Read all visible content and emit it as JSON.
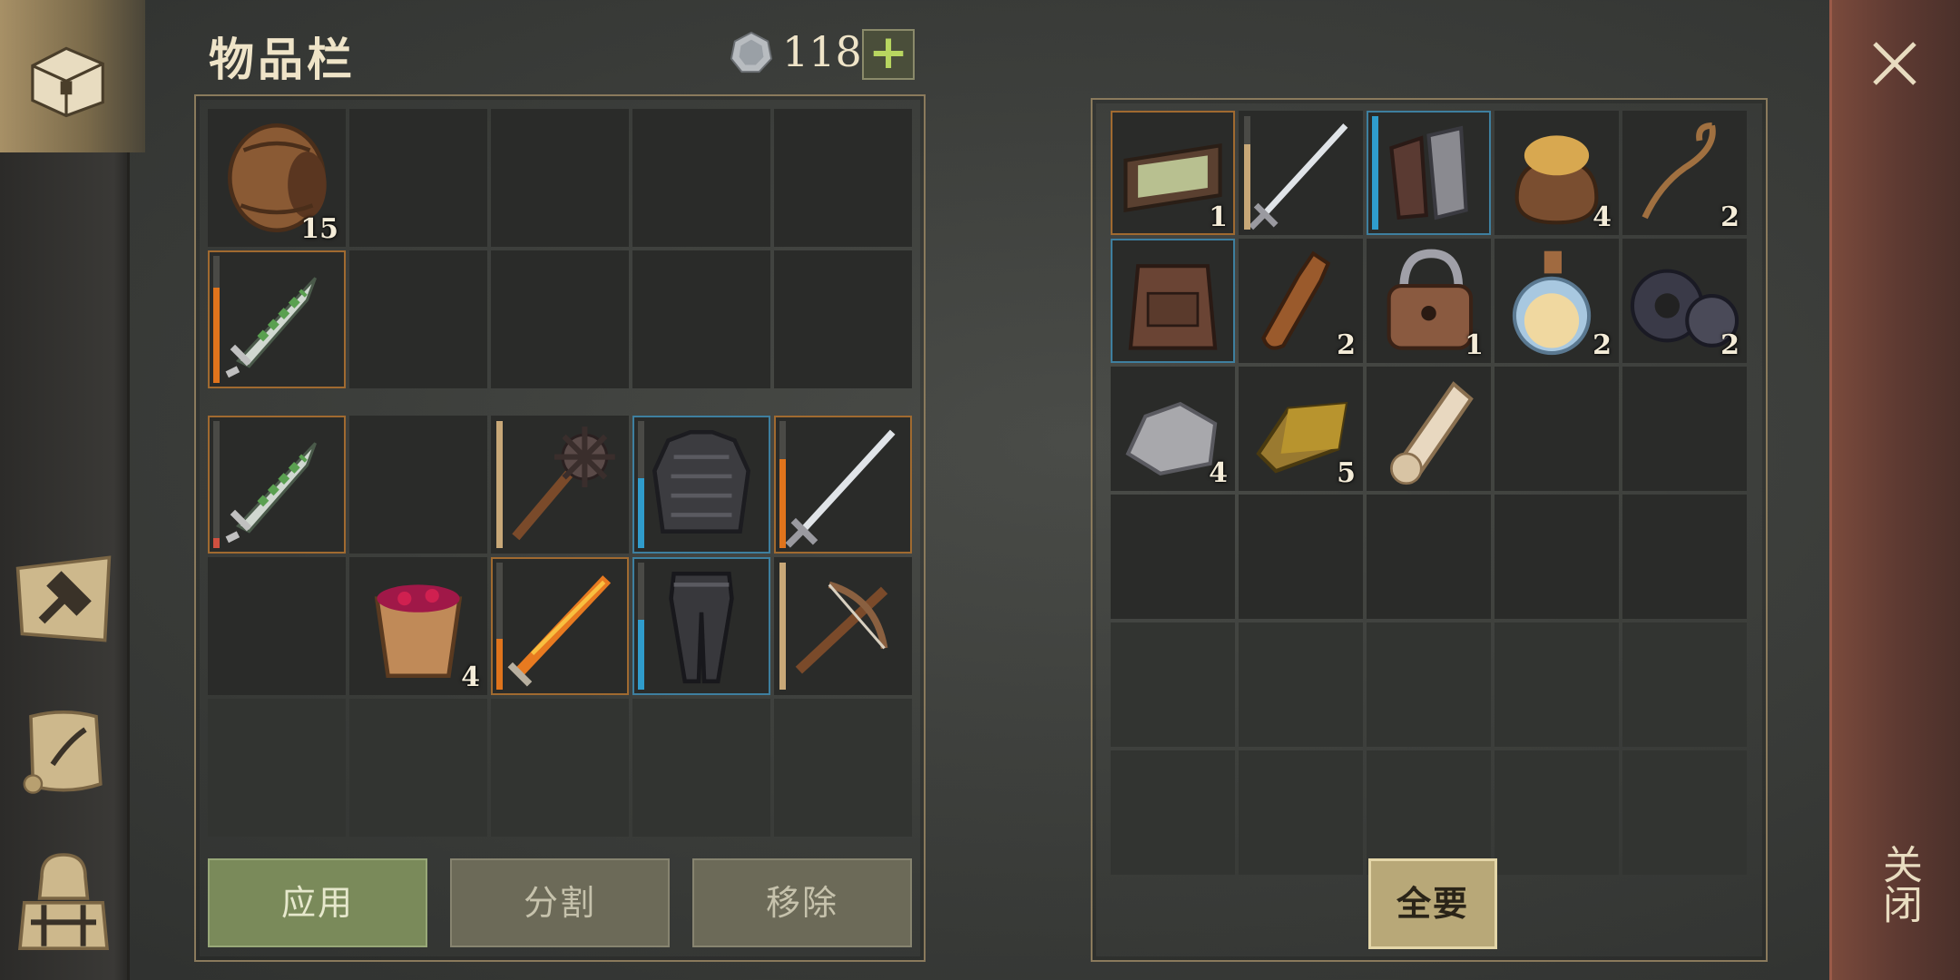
{
  "title": "物品栏",
  "currency": {
    "count": "118",
    "add_label": "+"
  },
  "buttons": {
    "apply": "应用",
    "split": "分割",
    "remove": "移除",
    "take_all": "全要"
  },
  "close": {
    "label": "关闭"
  },
  "nav": [
    "inventory-chest-icon",
    "crafting-hammer-icon",
    "journal-scroll-icon",
    "character-backpack-icon"
  ],
  "colors": {
    "rare_orange": "#e0741c",
    "rare_blue": "#2f9ccc",
    "tan": "#c8a878",
    "accent_green": "#b8d660"
  },
  "inventory_top": [
    {
      "icon": "barrel-icon",
      "qty": "15"
    },
    {},
    {},
    {},
    {},
    {
      "icon": "dagger-icon",
      "rarity": "orange",
      "durability": 0.75
    },
    {},
    {},
    {},
    {}
  ],
  "inventory_equip": [
    {
      "icon": "dagger-icon",
      "rarity": "orange",
      "durability": 0.08,
      "durColor": "#d05040"
    },
    {},
    {
      "icon": "mace-icon",
      "durability": 1.0,
      "durColor": "#c8a878"
    },
    {
      "icon": "chainmail-armor-icon",
      "rarity": "blue",
      "durability": 0.55,
      "durColor": "#2f9ccc"
    },
    {
      "icon": "longsword-icon",
      "rarity": "orange",
      "durability": 0.7,
      "durColor": "#e0741c"
    },
    {},
    {
      "icon": "berry-bucket-icon",
      "qty": "4"
    },
    {
      "icon": "flame-sword-icon",
      "rarity": "orange",
      "durability": 0.4,
      "durColor": "#e0741c"
    },
    {
      "icon": "armored-leggings-icon",
      "rarity": "blue",
      "durability": 0.55,
      "durColor": "#2f9ccc"
    },
    {
      "icon": "crossbow-icon",
      "durability": 1.0,
      "durColor": "#c8a878"
    }
  ],
  "container": [
    {
      "icon": "tray-icon",
      "rarity": "orange",
      "qty": "1"
    },
    {
      "icon": "longsword-icon",
      "durability": 0.75,
      "durColor": "#c8a878"
    },
    {
      "icon": "gauntlets-icon",
      "rarity": "blue",
      "durability": 1.0,
      "durColor": "#2f9ccc"
    },
    {
      "icon": "grain-sack-icon",
      "qty": "4"
    },
    {
      "icon": "rope-icon",
      "qty": "2"
    },
    {
      "icon": "backpack-icon",
      "rarity": "blue"
    },
    {
      "icon": "bottle-icon",
      "qty": "2"
    },
    {
      "icon": "padlock-icon",
      "qty": "1"
    },
    {
      "icon": "potion-flask-icon",
      "qty": "2"
    },
    {
      "icon": "gears-icon",
      "qty": "2"
    },
    {
      "icon": "stone-icon",
      "qty": "4"
    },
    {
      "icon": "gold-ingot-icon",
      "qty": "5"
    },
    {
      "icon": "scroll-icon"
    },
    {},
    {},
    {},
    {},
    {},
    {},
    {}
  ]
}
